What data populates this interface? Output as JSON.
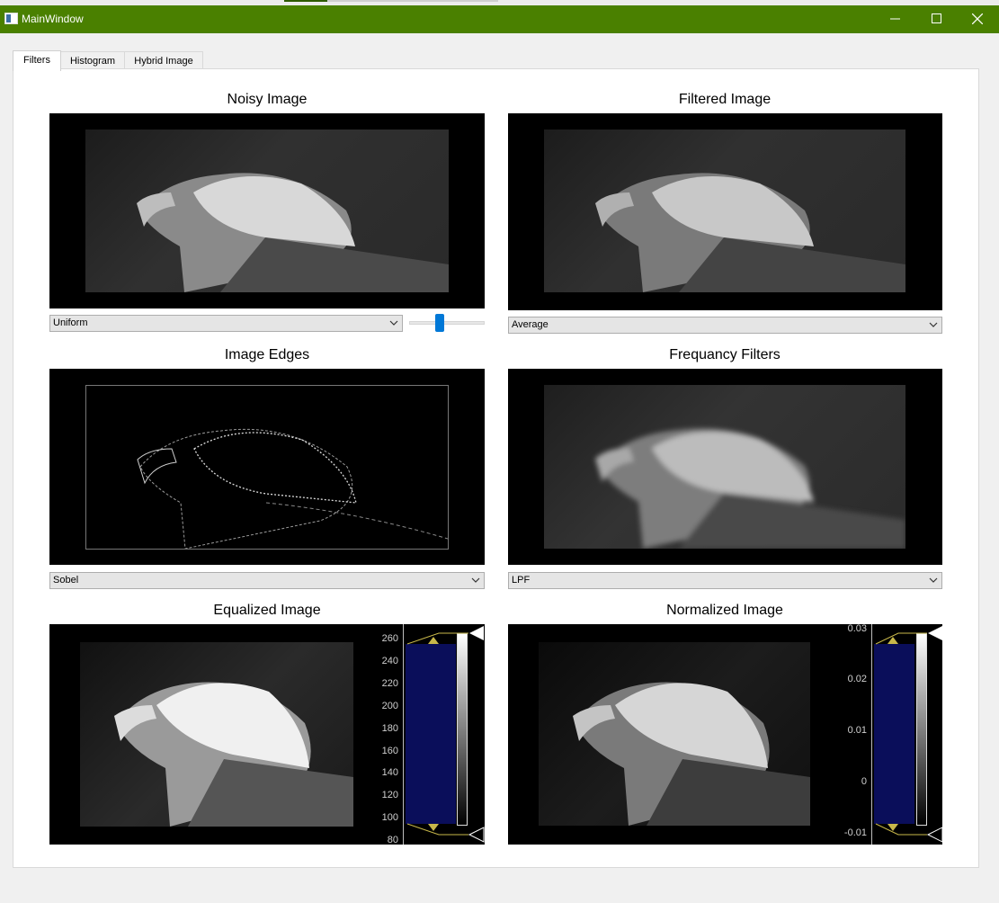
{
  "window": {
    "title": "MainWindow",
    "minimize_glyph": "─",
    "maximize_glyph": "☐",
    "close_glyph": "✕"
  },
  "tabs": [
    {
      "label": "Filters",
      "active": true
    },
    {
      "label": "Histogram",
      "active": false
    },
    {
      "label": "Hybrid Image",
      "active": false
    }
  ],
  "sections": {
    "noisy": {
      "title": "Noisy Image",
      "combo_value": "Uniform",
      "noise_level": 0.4
    },
    "filtered": {
      "title": "Filtered Image",
      "combo_value": "Average"
    },
    "edges": {
      "title": "Image Edges",
      "combo_value": "Sobel"
    },
    "frequency": {
      "title": "Frequancy Filters",
      "combo_value": "LPF"
    },
    "equalized": {
      "title": "Equalized Image",
      "ticks": [
        "260",
        "240",
        "220",
        "200",
        "180",
        "160",
        "140",
        "120",
        "100",
        "80"
      ]
    },
    "normalized": {
      "title": "Normalized Image",
      "ticks": [
        "0.03",
        "0.02",
        "0.01",
        "0",
        "-0.01"
      ]
    }
  },
  "colors": {
    "titlebar": "#4a8000",
    "accent": "#0078d7",
    "histogram_fill": "#0a0e5a",
    "level_marker": "#c8b84a"
  },
  "icons": {
    "app": "app-window-icon",
    "minimize": "minimize-icon",
    "maximize": "maximize-icon",
    "close": "close-icon",
    "dropdown": "chevron-down-icon"
  }
}
